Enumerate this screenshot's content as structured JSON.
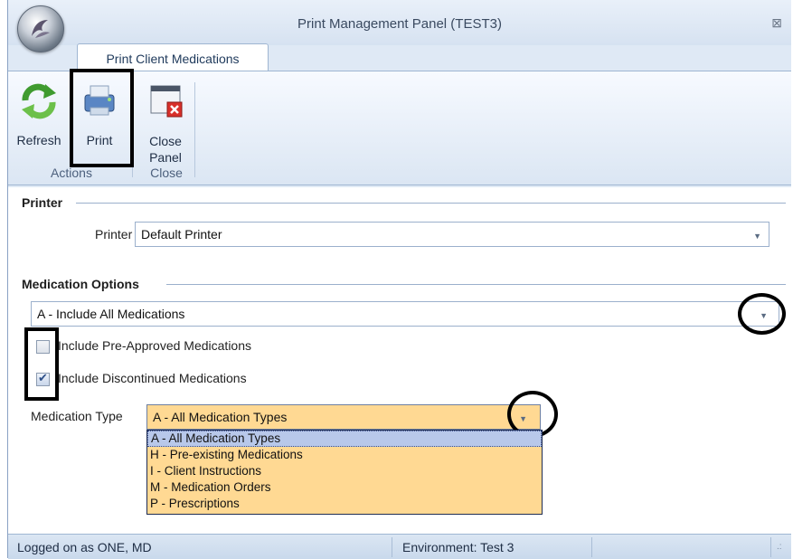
{
  "window": {
    "title": "Print Management Panel (TEST3)"
  },
  "tabs": [
    {
      "label": "Print Client Medications"
    }
  ],
  "ribbon": {
    "refresh_label": "Refresh",
    "print_label": "Print",
    "close_panel_line1": "Close",
    "close_panel_line2": "Panel",
    "group_actions": "Actions",
    "group_close": "Close"
  },
  "printer_section": {
    "title": "Printer",
    "label": "Printer",
    "value": "Default Printer"
  },
  "medication_section": {
    "title": "Medication Options",
    "include_value": "A - Include All Medications",
    "preapproved_label": "Include Pre-Approved Medications",
    "preapproved_checked": false,
    "discontinued_label": "Include Discontinued Medications",
    "discontinued_checked": true,
    "type_label": "Medication Type",
    "type_value": "A - All Medication Types",
    "type_options": [
      "A - All Medication Types",
      "H - Pre-existing Medications",
      "I - Client Instructions",
      "M - Medication Orders",
      "P - Prescriptions"
    ]
  },
  "statusbar": {
    "logged_on": "Logged on as ONE, MD",
    "environment": "Environment: Test 3"
  },
  "colors": {
    "dropdown_bg": "#ffd993",
    "selected_bg": "#b8c8ea",
    "ribbon_bg": "#dbe6f3"
  }
}
